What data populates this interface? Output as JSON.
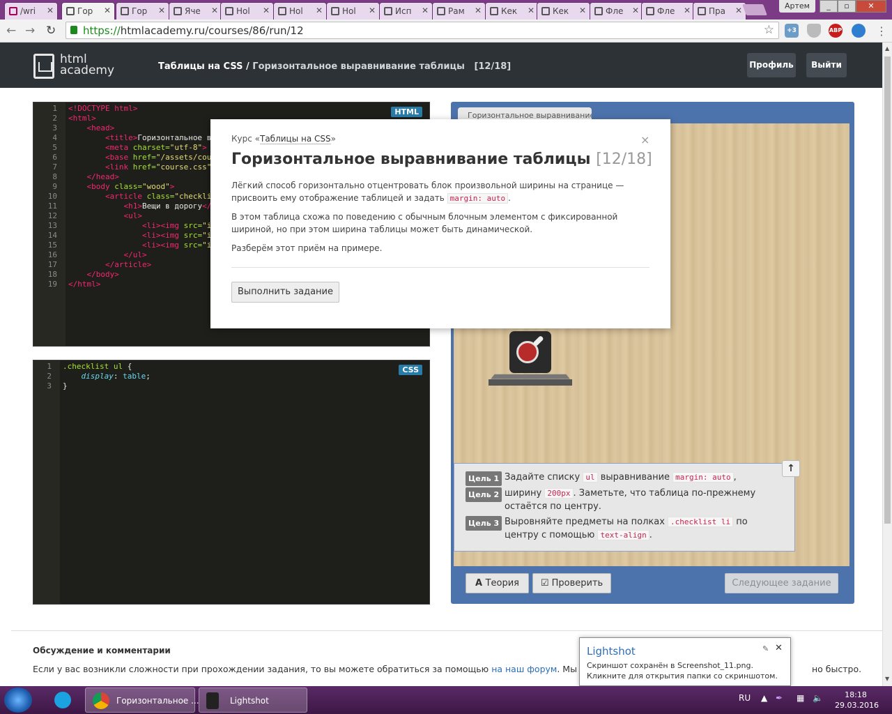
{
  "browser": {
    "tabs": [
      {
        "label": "/wri"
      },
      {
        "label": "Гор"
      },
      {
        "label": "Гор"
      },
      {
        "label": "Яче"
      },
      {
        "label": "Hol"
      },
      {
        "label": "Hol"
      },
      {
        "label": "Hol"
      },
      {
        "label": "Исп"
      },
      {
        "label": "Рам"
      },
      {
        "label": "Кек"
      },
      {
        "label": "Кек"
      },
      {
        "label": "Фле"
      },
      {
        "label": "Фле"
      },
      {
        "label": "Пра"
      }
    ],
    "user": "Артем",
    "url_scheme": "https://",
    "url_rest": "htmlacademy.ru/courses/86/run/12",
    "ext_badge": "+3",
    "abp_label": "ABP"
  },
  "header": {
    "logo_line1": "html",
    "logo_line2": "academy",
    "course": "Таблицы на CSS",
    "separator": "/",
    "lesson": "Горизонтальное выравнивание таблицы",
    "step": "[12/18]",
    "profile_btn": "Профиль",
    "logout_btn": "Выйти"
  },
  "html_editor": {
    "badge": "HTML",
    "line_numbers": "1\n2\n3\n4\n5\n6\n7\n8\n9\n10\n11\n12\n13\n14\n15\n16\n17\n18\n19"
  },
  "css_editor": {
    "badge": "CSS",
    "line_numbers": "1\n2\n3"
  },
  "preview": {
    "tab": "Горизонтальное выравнивание таб",
    "goals": [
      {
        "label": "Цель 1",
        "pre": "Задайте списку ",
        "code1": "ul",
        "mid": " выравнивание ",
        "code2": "margin: auto",
        "post": ","
      },
      {
        "label": "Цель 2",
        "pre": "ширину ",
        "code1": "200px",
        "post": ". Заметьте, что таблица по-прежнему остаётся по центру."
      },
      {
        "label": "Цель 3",
        "pre": "Выровняйте предметы на полках ",
        "code1": ".checklist li",
        "mid": " по центру с помощью ",
        "code2": "text-align",
        "post": "."
      }
    ],
    "theory_btn": "Теория",
    "check_btn": "Проверить",
    "next_btn": "Следующее задание"
  },
  "modal": {
    "course_prefix": "Курс «",
    "course_link": "Таблицы на CSS",
    "course_suffix": "»",
    "close": "×",
    "title": "Горизонтальное выравнивание таблицы",
    "counter": "[12/18]",
    "p1_pre": "Лёгкий способ горизонтально отцентровать блок произвольной ширины на странице — присвоить ему отображение таблицей и задать ",
    "p1_code": "margin: auto",
    "p1_post": ".",
    "p2": "В этом таблица схожа по поведению с обычным блочным элементом с фиксированной шириной, но при этом ширина таблицы может быть динамической.",
    "p3": "Разберём этот приём на примере.",
    "button": "Выполнить задание"
  },
  "comments": {
    "title": "Обсуждение и комментарии",
    "text_pre": "Если у вас возникли сложности при прохождении задания, то вы можете обратиться за помощью ",
    "link": "на наш форум",
    "text_mid": ". Мы отслежива",
    "text_end": "но быстро."
  },
  "notification": {
    "title": "Lightshot",
    "text": "Скриншот сохранён в Screenshot_11.png. Кликните для открытия папки со скриншотом."
  },
  "taskbar": {
    "chrome_label": "Горизонтальное ...",
    "lightshot_label": "Lightshot",
    "lang": "RU",
    "time": "18:18",
    "date": "29.03.2016"
  }
}
